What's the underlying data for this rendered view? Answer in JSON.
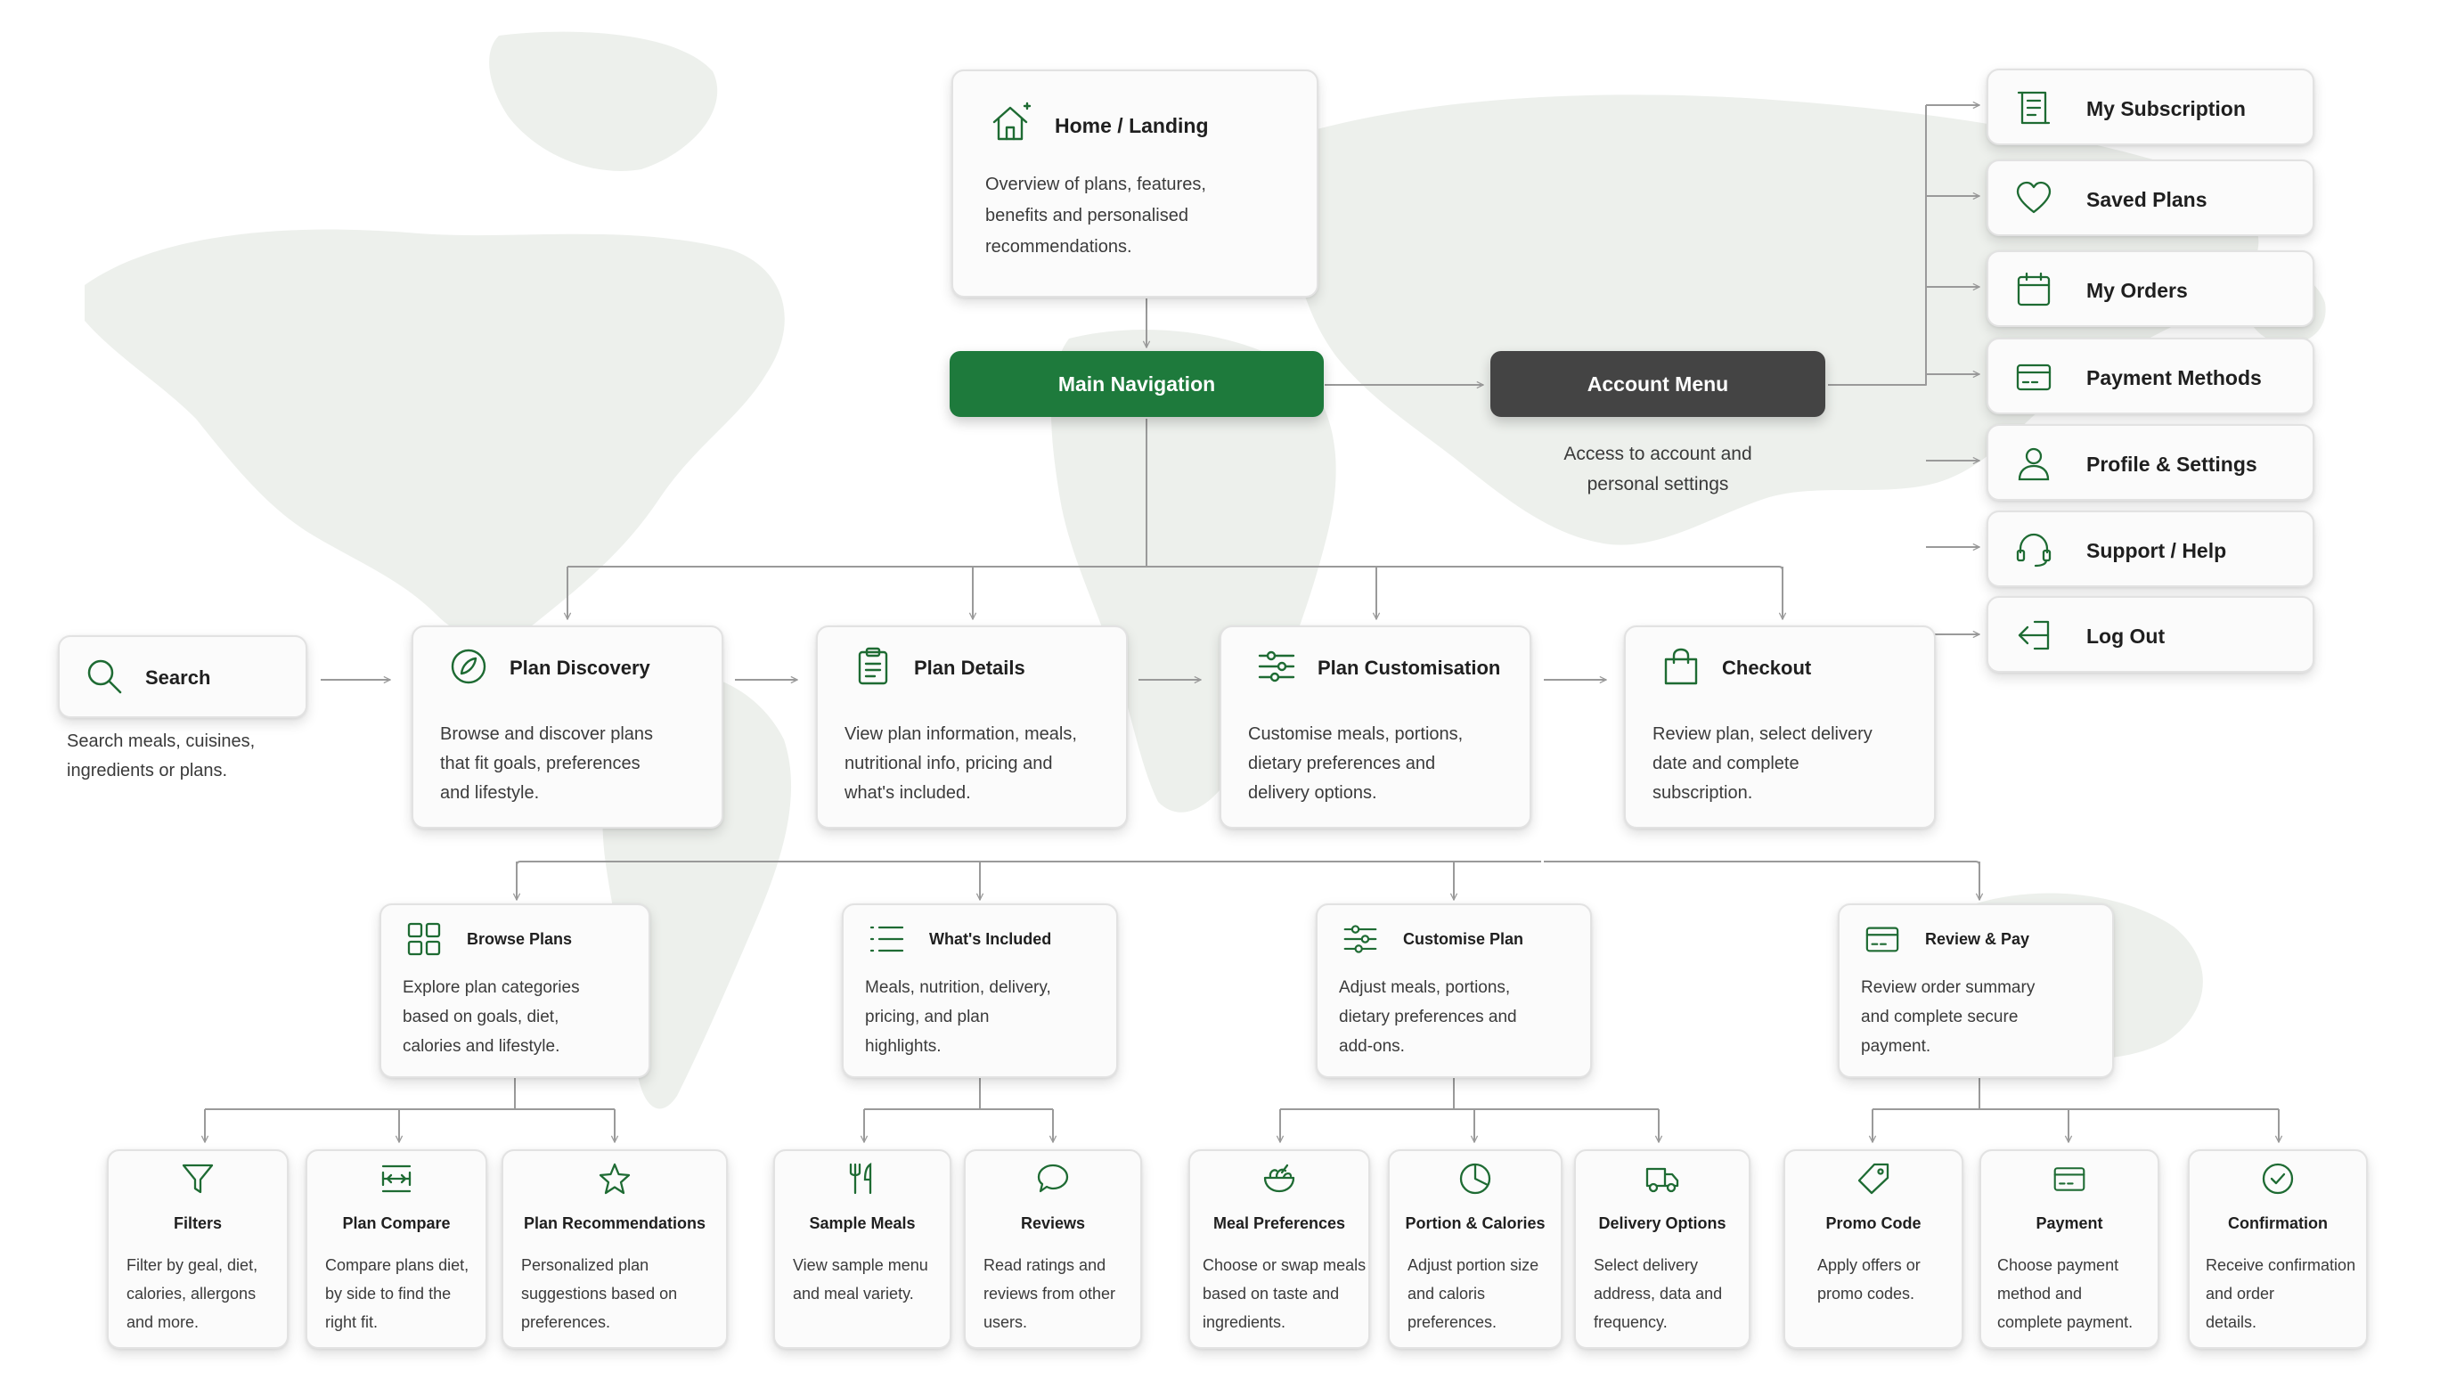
{
  "colors": {
    "accent_green": "#1e7a3c",
    "dark_gray": "#444444",
    "connector": "#9a9a9a",
    "icon_stroke": "#1e6b33"
  },
  "home": {
    "icon": "home-icon",
    "title": "Home / Landing",
    "desc": [
      "Overview of plans, features,",
      "benefits and personalised",
      "recommendations."
    ]
  },
  "main_nav": "Main Navigation",
  "account_menu": {
    "label": "Account Menu",
    "desc": [
      "Access to account and",
      "personal settings"
    ]
  },
  "account_items": [
    {
      "icon": "receipt-icon",
      "label": "My Subscription"
    },
    {
      "icon": "heart-icon",
      "label": "Saved Plans"
    },
    {
      "icon": "calendar-icon",
      "label": "My Orders"
    },
    {
      "icon": "credit-card-icon",
      "label": "Payment Methods"
    },
    {
      "icon": "user-icon",
      "label": "Profile & Settings"
    },
    {
      "icon": "headset-icon",
      "label": "Support / Help"
    },
    {
      "icon": "logout-icon",
      "label": "Log Out"
    }
  ],
  "search": {
    "icon": "search-icon",
    "title": "Search",
    "desc": [
      "Search meals, cuisines,",
      "ingredients or plans."
    ]
  },
  "flow": [
    {
      "icon": "compass-icon",
      "title": "Plan Discovery",
      "desc": [
        "Browse and discover plans",
        "that fit goals, preferences",
        "and lifestyle."
      ]
    },
    {
      "icon": "clipboard-icon",
      "title": "Plan Details",
      "desc": [
        "View plan information, meals,",
        "nutritional info, pricing and",
        "what's included."
      ]
    },
    {
      "icon": "sliders-icon",
      "title": "Plan Customisation",
      "desc": [
        "Customise meals, portions,",
        "dietary preferences and",
        "delivery options."
      ]
    },
    {
      "icon": "shopping-bag-icon",
      "title": "Checkout",
      "desc": [
        "Review plan, select delivery",
        "date and complete",
        "subscription."
      ]
    }
  ],
  "sub": [
    {
      "icon": "grid-icon",
      "title": "Browse Plans",
      "desc": [
        "Explore plan categories",
        "based on goals, diet,",
        "calories and lifestyle."
      ]
    },
    {
      "icon": "list-icon",
      "title": "What's Included",
      "desc": [
        "Meals, nutrition, delivery,",
        "pricing, and plan",
        "highlights."
      ]
    },
    {
      "icon": "sliders-icon",
      "title": "Customise Plan",
      "desc": [
        "Adjust meals, portions,",
        "dietary preferences and",
        "add-ons."
      ]
    },
    {
      "icon": "credit-card-icon",
      "title": "Review & Pay",
      "desc": [
        "Review order summary",
        "and complete secure",
        "payment."
      ]
    }
  ],
  "leaves": [
    {
      "icon": "filter-icon",
      "title": "Filters",
      "desc": [
        "Filter by geal, diet,",
        "calories, allergons",
        "and more."
      ]
    },
    {
      "icon": "compare-icon",
      "title": "Plan Compare",
      "desc": [
        "Compare plans diet,",
        "by side to find the",
        "right fit."
      ]
    },
    {
      "icon": "star-icon",
      "title": "Plan Recommendations",
      "desc": [
        "Personalized plan",
        "suggestions based on",
        "preferences."
      ]
    },
    {
      "icon": "utensils-icon",
      "title": "Sample Meals",
      "desc": [
        "View sample menu",
        "and meal variety."
      ]
    },
    {
      "icon": "chat-bubble-icon",
      "title": "Reviews",
      "desc": [
        "Read ratings and",
        "reviews from other",
        "users."
      ]
    },
    {
      "icon": "salad-bowl-icon",
      "title": "Meal Preferences",
      "desc": [
        "Choose or swap meals",
        "based on taste and",
        "ingredients."
      ]
    },
    {
      "icon": "pie-chart-icon",
      "title": "Portion & Calories",
      "desc": [
        "Adjust portion size",
        "and caloris",
        "preferences."
      ]
    },
    {
      "icon": "delivery-truck-icon",
      "title": "Delivery Options",
      "desc": [
        "Select delivery",
        "address, data and",
        "frequency."
      ]
    },
    {
      "icon": "tag-icon",
      "title": "Promo Code",
      "desc": [
        "Apply offers or",
        "promo codes."
      ]
    },
    {
      "icon": "credit-card-icon",
      "title": "Payment",
      "desc": [
        "Choose payment",
        "method and",
        "complete payment."
      ]
    },
    {
      "icon": "check-circle-icon",
      "title": "Confirmation",
      "desc": [
        "Receive confirmation",
        "and order",
        "details."
      ]
    }
  ]
}
